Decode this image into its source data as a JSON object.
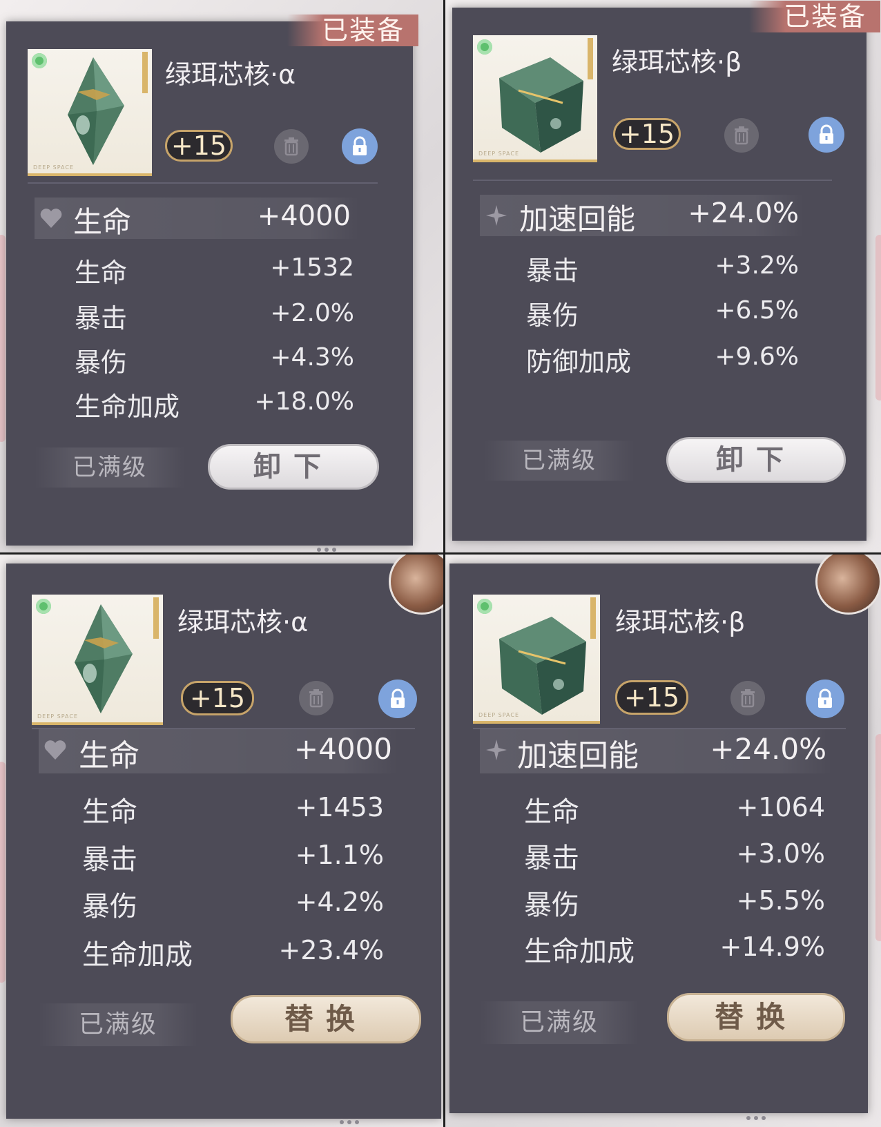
{
  "panels": [
    {
      "equipped_tag": "已装备",
      "name": "绿珥芯核·α",
      "level": "+15",
      "main_stat": {
        "label": "生命",
        "value": "+4000"
      },
      "sub_stats": [
        {
          "label": "生命",
          "value": "+1532"
        },
        {
          "label": "暴击",
          "value": "+2.0%"
        },
        {
          "label": "暴伤",
          "value": "+4.3%"
        },
        {
          "label": "生命加成",
          "value": "+18.0%"
        }
      ],
      "maxed_label": "已满级",
      "action_label": "卸下"
    },
    {
      "equipped_tag": "已装备",
      "name": "绿珥芯核·β",
      "level": "+15",
      "main_stat": {
        "label": "加速回能",
        "value": "+24.0%"
      },
      "sub_stats": [
        {
          "label": "暴击",
          "value": "+3.2%"
        },
        {
          "label": "暴伤",
          "value": "+6.5%"
        },
        {
          "label": "防御加成",
          "value": "+9.6%"
        }
      ],
      "maxed_label": "已满级",
      "action_label": "卸下"
    },
    {
      "name": "绿珥芯核·α",
      "level": "+15",
      "main_stat": {
        "label": "生命",
        "value": "+4000"
      },
      "sub_stats": [
        {
          "label": "生命",
          "value": "+1453"
        },
        {
          "label": "暴击",
          "value": "+1.1%"
        },
        {
          "label": "暴伤",
          "value": "+4.2%"
        },
        {
          "label": "生命加成",
          "value": "+23.4%"
        }
      ],
      "maxed_label": "已满级",
      "action_label": "替换"
    },
    {
      "name": "绿珥芯核·β",
      "level": "+15",
      "main_stat": {
        "label": "加速回能",
        "value": "+24.0%"
      },
      "sub_stats": [
        {
          "label": "生命",
          "value": "+1064"
        },
        {
          "label": "暴击",
          "value": "+3.0%"
        },
        {
          "label": "暴伤",
          "value": "+5.5%"
        },
        {
          "label": "生命加成",
          "value": "+14.9%"
        }
      ],
      "maxed_label": "已满级",
      "action_label": "替换"
    }
  ],
  "colors": {
    "card_bg": "#4d4b57",
    "equipped_tag": "#b8736e",
    "lock_blue": "#7ea3dc",
    "level_border": "#c7a46a"
  }
}
